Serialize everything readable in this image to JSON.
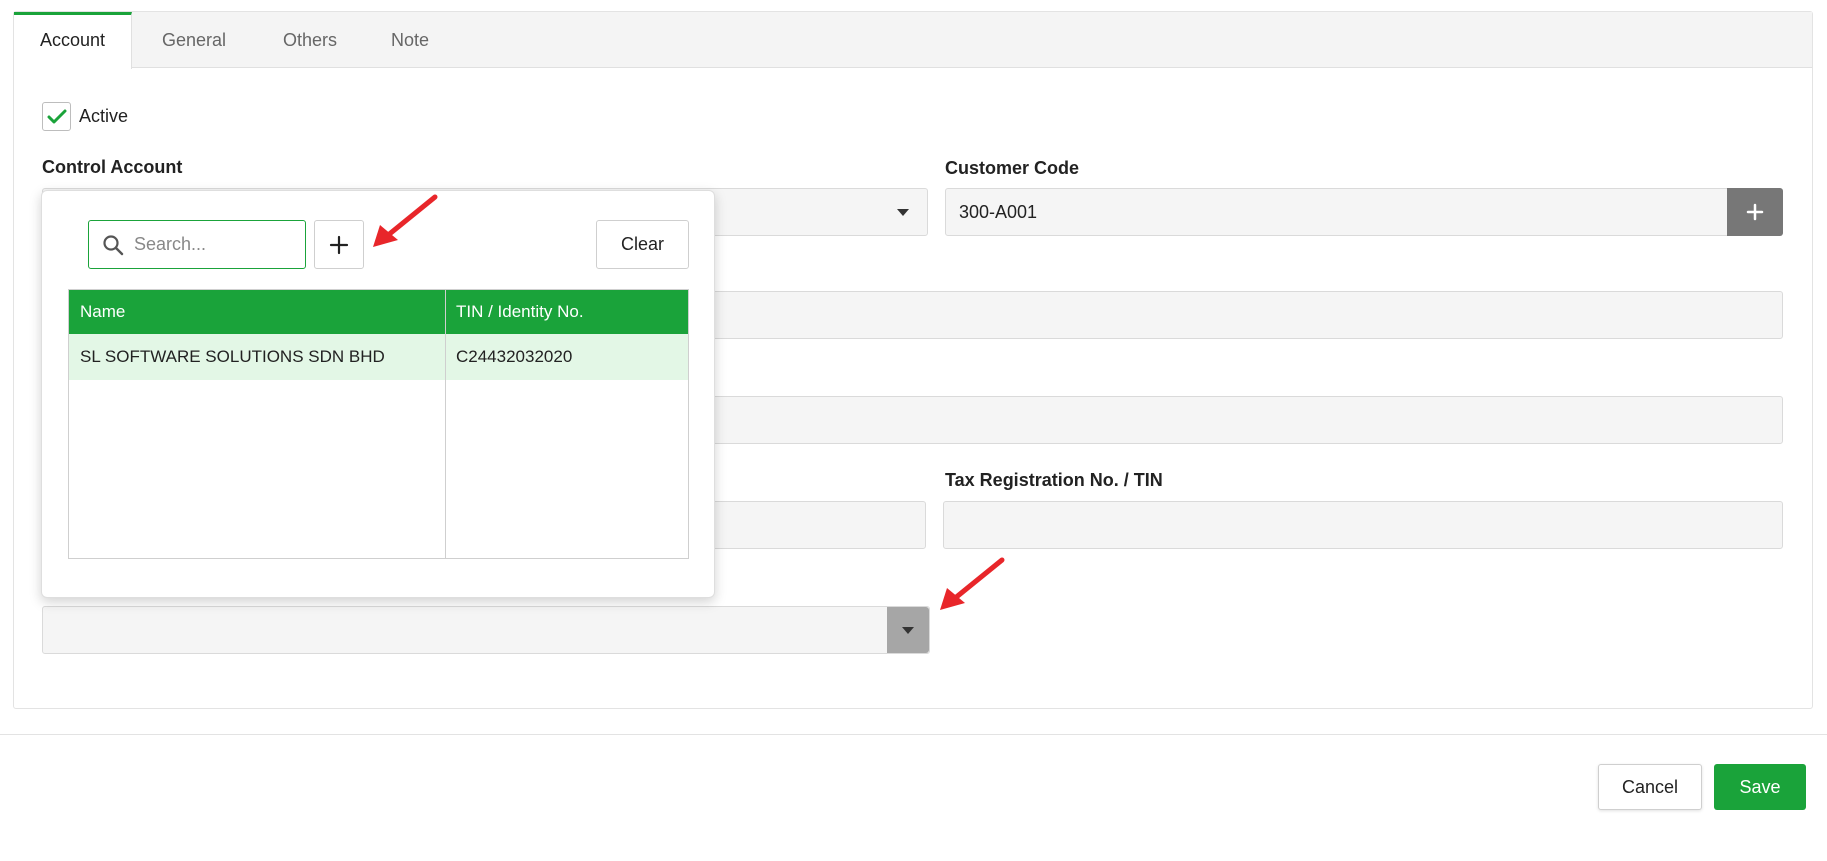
{
  "tabs": [
    {
      "label": "Account",
      "active": true
    },
    {
      "label": "General",
      "active": false
    },
    {
      "label": "Others",
      "active": false
    },
    {
      "label": "Note",
      "active": false
    }
  ],
  "form": {
    "active_label": "Active",
    "active_checked": true,
    "control_account_label": "Control Account",
    "customer_code_label": "Customer Code",
    "customer_code_value": "300-A001",
    "tax_registration_label": "Tax Registration No. / TIN",
    "tax_registration_value": ""
  },
  "popup": {
    "search_placeholder": "Search...",
    "clear_label": "Clear",
    "columns": [
      "Name",
      "TIN / Identity No."
    ],
    "rows": [
      {
        "name": "SL SOFTWARE SOLUTIONS SDN BHD",
        "tin": "C24432032020"
      }
    ]
  },
  "footer": {
    "cancel_label": "Cancel",
    "save_label": "Save"
  },
  "colors": {
    "accent": "#1aa33a",
    "annotation_arrow": "#e8262a"
  }
}
